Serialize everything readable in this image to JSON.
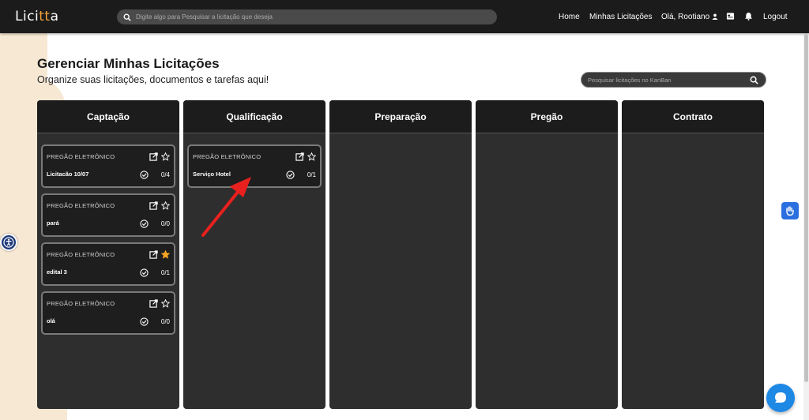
{
  "app": {
    "logo_prefix": "Lici",
    "logo_accent": "tt",
    "logo_suffix": "a",
    "accent_color": "#f2a33a"
  },
  "topbar": {
    "search_placeholder": "Digite algo para Pesquisar a licitação que deseja",
    "nav_home": "Home",
    "nav_minhas": "Minhas Licitações",
    "nav_user": "Olá, Rootiano",
    "nav_logout": "Logout"
  },
  "page": {
    "title": "Gerenciar Minhas Licitações",
    "subtitle": "Organize suas licitações, documentos e tarefas aqui!",
    "kanban_search_placeholder": "Pesquisar licitações no KanBan"
  },
  "columns": [
    {
      "title": "Captação",
      "cards": [
        {
          "type": "PREGÃO ELETRÔNICO",
          "title": "Licitacão 10/07",
          "count": "0/4",
          "starred": false
        },
        {
          "type": "PREGÃO ELETRÔNICO",
          "title": "pará",
          "count": "0/0",
          "starred": false
        },
        {
          "type": "PREGÃO ELETRÔNICO",
          "title": "edital 3",
          "count": "0/1",
          "starred": true
        },
        {
          "type": "PREGÃO ELETRÔNICO",
          "title": "olá",
          "count": "0/0",
          "starred": false
        }
      ]
    },
    {
      "title": "Qualificação",
      "cards": [
        {
          "type": "PREGÃO ELETRÔNICO",
          "title": "Serviço Hotel",
          "count": "0/1",
          "starred": false
        }
      ]
    },
    {
      "title": "Preparação",
      "cards": []
    },
    {
      "title": "Pregão",
      "cards": []
    },
    {
      "title": "Contrato",
      "cards": []
    }
  ],
  "colors": {
    "topbar": "#1b1b1b",
    "column": "#2e2e2e",
    "star_active": "#f5a623",
    "annotation_arrow": "#e8201e",
    "chat": "#1e88e5"
  }
}
